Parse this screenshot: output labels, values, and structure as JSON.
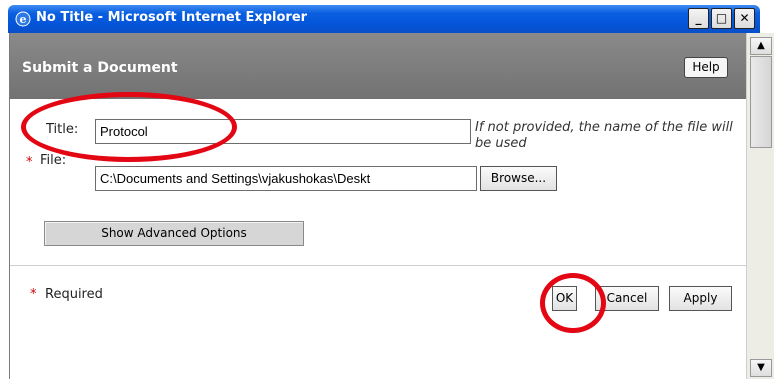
{
  "window": {
    "title": "No Title - Microsoft Internet Explorer",
    "minimize": "_",
    "maximize": "□",
    "close": "✕"
  },
  "header": {
    "title": "Submit a Document",
    "help_label": "Help"
  },
  "form": {
    "title_label": "Title:",
    "title_value": "Protocol",
    "title_hint": "If not provided, the name of the file will be used",
    "required_star": "*",
    "file_label": "File:",
    "file_value": "C:\\Documents and Settings\\vjakushokas\\Deskt",
    "browse_label": "Browse...",
    "advanced_label": "Show Advanced Options"
  },
  "footer": {
    "required_label": "Required",
    "ok_label": "OK",
    "cancel_label": "Cancel",
    "apply_label": "Apply"
  },
  "colors": {
    "titlebar": "#0454d8",
    "header": "#7c7c7c",
    "required": "#d40000",
    "annotation": "#e30613"
  },
  "icons": [
    "ie-icon",
    "minimize-icon",
    "maximize-icon",
    "close-icon",
    "scroll-up-icon",
    "scroll-down-icon"
  ]
}
